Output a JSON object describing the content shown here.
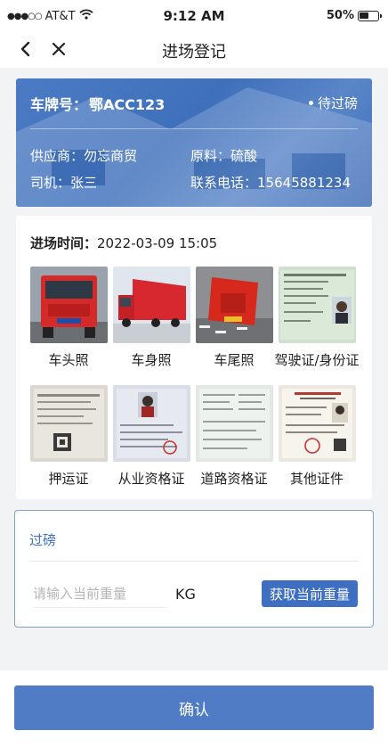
{
  "status_bar": {
    "carrier": "AT&T",
    "signal_dots": "●●●○○",
    "time": "9:12 AM",
    "battery_text": "50%",
    "battery_level": 0.5,
    "wifi_icon": "wifi-icon",
    "battery_icon": "battery-icon"
  },
  "nav": {
    "title": "进场登记",
    "back_icon": "chevron-left-icon",
    "close_icon": "close-icon"
  },
  "vehicle": {
    "plate_label": "车牌号：",
    "plate": "鄂ACC123",
    "status": "待过磅",
    "supplier_label": "供应商：",
    "supplier": "勿忘商贸",
    "material_label": "原料：",
    "material": "硫酸",
    "driver_label": "司机：",
    "driver": "张三",
    "phone_label": "联系电话：",
    "phone": "15645881234"
  },
  "photos": {
    "time_label": "进场时间：",
    "time": "2022-03-09 15:05",
    "items": [
      {
        "label": "车头照"
      },
      {
        "label": "车身照"
      },
      {
        "label": "车尾照"
      },
      {
        "label": "驾驶证/身份证"
      },
      {
        "label": "押运证"
      },
      {
        "label": "从业资格证"
      },
      {
        "label": "道路资格证"
      },
      {
        "label": "其他证件"
      }
    ]
  },
  "weigh": {
    "title": "过磅",
    "input_placeholder": "请输入当前重量",
    "input_value": "",
    "unit": "KG",
    "fetch_button": "获取当前重量"
  },
  "footer": {
    "confirm_button": "确认"
  },
  "colors": {
    "primary": "#3e6fc0",
    "card_blue": "#4b7bc4",
    "border_blue": "#7f9fd0"
  }
}
